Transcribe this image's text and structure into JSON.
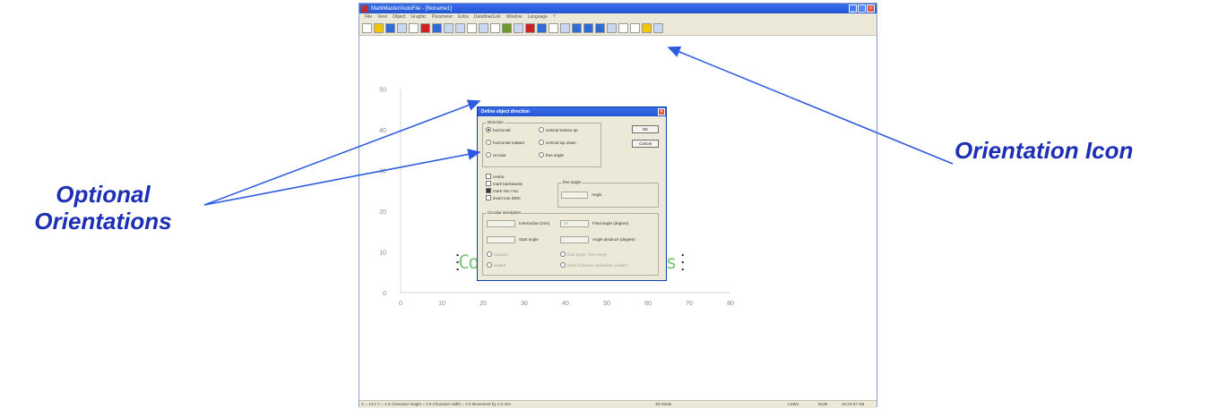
{
  "window": {
    "title": "MarkMaster/AutoFile - [Noname1]",
    "buttons": {
      "minimize": "_",
      "maximize": "□",
      "close": "×"
    }
  },
  "menu": [
    "File",
    "View",
    "Object",
    "Graphic",
    "Parameter",
    "Extra",
    "Dataflow/Link",
    "Window",
    "Language",
    "?"
  ],
  "toolbar": {
    "icons": [
      "new-file-icon",
      "open-icon",
      "save-icon",
      "print-icon",
      "text-icon",
      "barcode-icon",
      "move-icon",
      "undo-icon",
      "redo-icon",
      "zoom-1to1-icon",
      "zoom-fit-icon",
      "abc-text-icon",
      "grid-icon",
      "layout-icon",
      "color-icon",
      "properties-icon",
      "frame-icon",
      "object-list-icon",
      "align-left-icon",
      "align-right-icon",
      "orientation-icon",
      "text-mode-icon",
      "abort-icon",
      "close-icon",
      "help-icon",
      "context-help-icon"
    ]
  },
  "chart_data": {
    "type": "scatter",
    "xticks": [
      "0",
      "10",
      "20",
      "30",
      "40",
      "50",
      "60",
      "70",
      "80"
    ],
    "yticks": [
      "0",
      "10",
      "20",
      "30",
      "40",
      "50"
    ],
    "xlim": [
      0,
      80
    ],
    "ylim": [
      0,
      50
    ],
    "grid": false
  },
  "canvas_text": "Columbia Marking Tools",
  "colors": {
    "canvas_text": "#7ec47e",
    "callout": "#1c2fb5",
    "arrow": "#2d5be0"
  },
  "dialog": {
    "title": "Define object direction",
    "direction_caption": "Direction",
    "directions": [
      {
        "label": "horizontal",
        "checked": true
      },
      {
        "label": "vertical bottom-up",
        "checked": false
      },
      {
        "label": "horizontal rotated",
        "checked": false
      },
      {
        "label": "vertical top down",
        "checked": false
      },
      {
        "label": "circular",
        "checked": false
      },
      {
        "label": "free angle",
        "checked": false
      }
    ],
    "ok_label": "OK",
    "cancel_label": "Cancel",
    "options": [
      {
        "label": "centre",
        "checked": false
      },
      {
        "label": "mark backwards",
        "checked": false
      },
      {
        "label": "mark Yes / No",
        "checked": true
      },
      {
        "label": "insert into DMC",
        "checked": false
      }
    ],
    "free_angle_caption": "free angle",
    "angle_label": "Angle",
    "circular_caption": "Circular inscription",
    "inner_radius_label": "Innerradius (mm)",
    "final_angle_label": "Final angle (degree)",
    "start_angle_label": "Start angle",
    "angle_distance_label": "Angle distance (degree)",
    "inner_radius_value": "10",
    "circ_opts": [
      "outward",
      "inward"
    ],
    "angle_opts": [
      "final angle / free angle",
      "fixed character separation (angle)"
    ]
  },
  "status": {
    "coords": "X = 14.2  Y = 4.6  Character height = 3.0  Character width = 2.0  Movement by 1.0 mm",
    "mode": "3D Mode",
    "layer": "LSW1",
    "num": "NUM",
    "time": "10:24:57 AM"
  },
  "callouts": {
    "left": "Optional Orientations",
    "right": "Orientation Icon"
  }
}
